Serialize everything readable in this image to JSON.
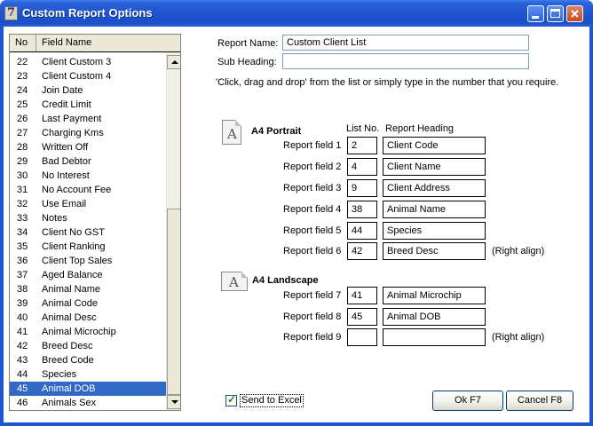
{
  "window": {
    "title": "Custom Report Options",
    "app_icon": "7"
  },
  "list": {
    "header_no": "No",
    "header_field": "Field Name",
    "rows": [
      {
        "no": "22",
        "name": "Client Custom 3"
      },
      {
        "no": "23",
        "name": "Client Custom 4"
      },
      {
        "no": "24",
        "name": "Join Date"
      },
      {
        "no": "25",
        "name": "Credit Limit"
      },
      {
        "no": "26",
        "name": "Last Payment"
      },
      {
        "no": "27",
        "name": "Charging Kms"
      },
      {
        "no": "28",
        "name": "Written Off"
      },
      {
        "no": "29",
        "name": "Bad Debtor"
      },
      {
        "no": "30",
        "name": "No Interest"
      },
      {
        "no": "31",
        "name": "No Account Fee"
      },
      {
        "no": "32",
        "name": "Use Email"
      },
      {
        "no": "33",
        "name": "Notes"
      },
      {
        "no": "34",
        "name": "Client No GST"
      },
      {
        "no": "35",
        "name": "Client Ranking"
      },
      {
        "no": "36",
        "name": "Client Top Sales"
      },
      {
        "no": "37",
        "name": "Aged Balance"
      },
      {
        "no": "38",
        "name": "Animal Name"
      },
      {
        "no": "39",
        "name": "Animal Code"
      },
      {
        "no": "40",
        "name": "Animal Desc"
      },
      {
        "no": "41",
        "name": "Animal Microchip"
      },
      {
        "no": "42",
        "name": "Breed Desc"
      },
      {
        "no": "43",
        "name": "Breed Code"
      },
      {
        "no": "44",
        "name": "Species"
      },
      {
        "no": "45",
        "name": "Animal DOB"
      },
      {
        "no": "46",
        "name": "Animals Sex"
      }
    ],
    "selected_no": "45"
  },
  "report": {
    "name_label": "Report Name:",
    "name_value": "Custom Client List",
    "subheading_label": "Sub Heading:",
    "subheading_value": "",
    "instructions": "'Click, drag and drop' from the list or simply type in the number that you require."
  },
  "portrait": {
    "title": "A4 Portrait",
    "col_list_no": "List No.",
    "col_heading": "Report Heading",
    "fields": [
      {
        "label": "Report field 1",
        "no": "2",
        "heading": "Client Code",
        "note": ""
      },
      {
        "label": "Report field 2",
        "no": "4",
        "heading": "Client Name",
        "note": ""
      },
      {
        "label": "Report field 3",
        "no": "9",
        "heading": "Client Address",
        "note": ""
      },
      {
        "label": "Report field 4",
        "no": "38",
        "heading": "Animal Name",
        "note": ""
      },
      {
        "label": "Report field 5",
        "no": "44",
        "heading": "Species",
        "note": ""
      },
      {
        "label": "Report field 6",
        "no": "42",
        "heading": "Breed Desc",
        "note": "(Right align)"
      }
    ]
  },
  "landscape": {
    "title": "A4 Landscape",
    "fields": [
      {
        "label": "Report field 7",
        "no": "41",
        "heading": "Animal Microchip",
        "note": ""
      },
      {
        "label": "Report field 8",
        "no": "45",
        "heading": "Animal DOB",
        "note": ""
      },
      {
        "label": "Report field 9",
        "no": "",
        "heading": "",
        "note": "(Right align)"
      }
    ]
  },
  "icons": {
    "page_glyph": "A"
  },
  "footer": {
    "send_excel_label": "Send to Excel",
    "send_excel_checked": true,
    "ok_label": "Ok F7",
    "cancel_label": "Cancel F8"
  }
}
